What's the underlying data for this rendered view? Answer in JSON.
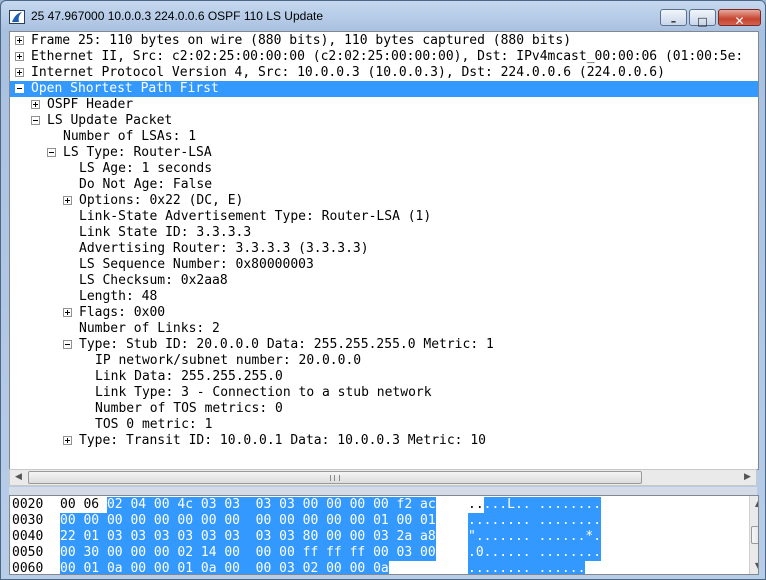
{
  "window": {
    "title": "25 47.967000 10.0.0.3 224.0.0.6 OSPF 110 LS Update",
    "minimize_glyph": "–",
    "maximize_glyph": "□",
    "close_glyph": "✕"
  },
  "tree": [
    {
      "text": "Frame 25: 110 bytes on wire (880 bits), 110 bytes captured (880 bits)",
      "expander": "plus",
      "indent": 0
    },
    {
      "text": "Ethernet II, Src: c2:02:25:00:00:00 (c2:02:25:00:00:00), Dst: IPv4mcast_00:00:06 (01:00:5e:",
      "expander": "plus",
      "indent": 0
    },
    {
      "text": "Internet Protocol Version 4, Src: 10.0.0.3 (10.0.0.3), Dst: 224.0.0.6 (224.0.0.6)",
      "expander": "plus",
      "indent": 0
    },
    {
      "text": "Open Shortest Path First",
      "expander": "minus",
      "indent": 0,
      "selected": true
    },
    {
      "text": "OSPF Header",
      "expander": "plus",
      "indent": 1
    },
    {
      "text": "LS Update Packet",
      "expander": "minus",
      "indent": 1
    },
    {
      "text": "Number of LSAs: 1",
      "expander": "",
      "indent": 2
    },
    {
      "text": "LS Type: Router-LSA",
      "expander": "minus",
      "indent": 2
    },
    {
      "text": "LS Age: 1 seconds",
      "expander": "",
      "indent": 3
    },
    {
      "text": "Do Not Age: False",
      "expander": "",
      "indent": 3
    },
    {
      "text": "Options: 0x22 (DC, E)",
      "expander": "plus",
      "indent": 3
    },
    {
      "text": "Link-State Advertisement Type: Router-LSA (1)",
      "expander": "",
      "indent": 3
    },
    {
      "text": "Link State ID: 3.3.3.3",
      "expander": "",
      "indent": 3
    },
    {
      "text": "Advertising Router: 3.3.3.3 (3.3.3.3)",
      "expander": "",
      "indent": 3
    },
    {
      "text": "LS Sequence Number: 0x80000003",
      "expander": "",
      "indent": 3
    },
    {
      "text": "LS Checksum: 0x2aa8",
      "expander": "",
      "indent": 3
    },
    {
      "text": "Length: 48",
      "expander": "",
      "indent": 3
    },
    {
      "text": "Flags: 0x00",
      "expander": "plus",
      "indent": 3
    },
    {
      "text": "Number of Links: 2",
      "expander": "",
      "indent": 3
    },
    {
      "text": "Type: Stub     ID: 20.0.0.0        Data: 255.255.255.0   Metric: 1",
      "expander": "minus",
      "indent": 3
    },
    {
      "text": "IP network/subnet number: 20.0.0.0",
      "expander": "",
      "indent": 4
    },
    {
      "text": "Link Data: 255.255.255.0",
      "expander": "",
      "indent": 4
    },
    {
      "text": "Link Type: 3 - Connection to a stub network",
      "expander": "",
      "indent": 4
    },
    {
      "text": "Number of TOS metrics: 0",
      "expander": "",
      "indent": 4
    },
    {
      "text": "TOS 0 metric: 1",
      "expander": "",
      "indent": 4
    },
    {
      "text": "Type: Transit  ID: 10.0.0.1        Data: 10.0.0.3        Metric: 10",
      "expander": "plus",
      "indent": 3
    }
  ],
  "hscroll": {
    "left_arrow": "◀",
    "right_arrow": "▶"
  },
  "vscroll": {
    "up_arrow": "▲",
    "down_arrow": "▼"
  },
  "hex": [
    {
      "offset": "0020",
      "plain_hex": "00 06 ",
      "sel_hex": "02 04 00 4c 03 03  03 03 00 00 00 00 f2 ac",
      "plain_ascii": "..",
      "sel_ascii": "...L.. ........"
    },
    {
      "offset": "0030",
      "plain_hex": "",
      "sel_hex": "00 00 00 00 00 00 00 00  00 00 00 00 00 01 00 01",
      "plain_ascii": "",
      "sel_ascii": "........ ........"
    },
    {
      "offset": "0040",
      "plain_hex": "",
      "sel_hex": "22 01 03 03 03 03 03 03  03 03 80 00 00 03 2a a8",
      "plain_ascii": "",
      "sel_ascii": "\"....... ......*."
    },
    {
      "offset": "0050",
      "plain_hex": "",
      "sel_hex": "00 30 00 00 00 02 14 00  00 00 ff ff ff 00 03 00",
      "plain_ascii": "",
      "sel_ascii": ".0...... ........"
    },
    {
      "offset": "0060",
      "plain_hex": "",
      "sel_hex": "00 01 0a 00 00 01 0a 00  00 03 02 00 00 0a",
      "plain_ascii": "",
      "sel_ascii": "........ ......"
    }
  ]
}
